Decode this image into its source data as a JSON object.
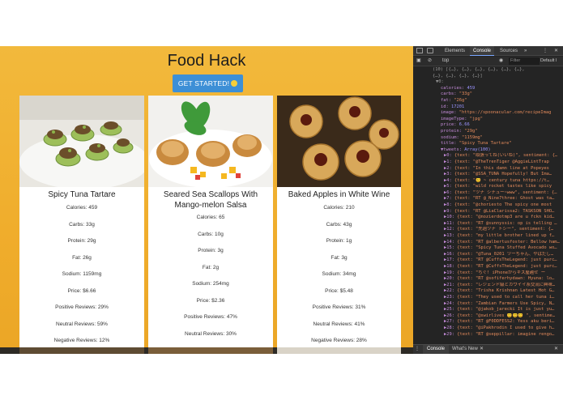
{
  "app": {
    "title": "Food Hack",
    "cta_label": "GET STARTED!",
    "recipes": [
      {
        "name": "Spicy Tuna Tartare",
        "stats": [
          "Calories: 459",
          "Carbs: 33g",
          "Protein: 29g",
          "Fat: 26g",
          "Sodium: 1159mg",
          "Price: $6.66",
          "Positive Reviews: 29%",
          "Neutral Reviews: 59%",
          "Negative Reviews: 12%"
        ]
      },
      {
        "name": "Seared Sea Scallops With Mango-melon Salsa",
        "stats": [
          "Calories: 65",
          "Carbs: 10g",
          "Protein: 3g",
          "Fat: 2g",
          "Sodium: 254mg",
          "Price: $2.36",
          "Positive Reviews: 47%",
          "Neutral Reviews: 30%",
          "Negative Reviews: 23%"
        ]
      },
      {
        "name": "Baked Apples in White Wine",
        "stats": [
          "Calories: 210",
          "Carbs: 43g",
          "Protein: 1g",
          "Fat: 3g",
          "Sodium: 34mg",
          "Price: $5.48",
          "Positive Reviews: 31%",
          "Neutral Reviews: 41%",
          "Negative Reviews: 28%"
        ]
      }
    ]
  },
  "devtools": {
    "tabs": [
      "Elements",
      "Console",
      "Sources",
      "»"
    ],
    "context": "top",
    "filter_placeholder": "Filter",
    "level": "Default l",
    "console_lines": [
      "(10) [{…}, {…}, {…}, {…}, {…}, {…},",
      "{…}, {…}, {…}, {…}] ",
      "▼0:",
      "calories: 459",
      "carbs: \"33g\"",
      "fat: \"26g\"",
      "id: 17201",
      "image: \"https://spoonacular.com/recipeImag",
      "imageType: \"jpg\"",
      "price: 6.66",
      "protein: \"29g\"",
      "sodium: \"1159mg\"",
      "title: \"Spicy Tuna Tartare\"",
      "▼tweets: Array(100)",
      "▶0: {text: \"頑張ってね(いいね)\", sentiment: {…",
      "▶1: {text: \"@TheTrenTiger @AggieLintTrap",
      "▶2: {text: \"In this damn line at Popeyes",
      "▶3: {text: \"@SSA_TUNA Hopefully! But Ima…",
      "▶4: {text: \"😊 ~ century tuna https://t…",
      "▶5: {text: \"wild rocket tastes like spicy",
      "▶6: {text: \"ツナ シチュー~www\", sentiment: {…",
      "▶7: {text: \"RT @_Nine7three: Ghost was ta…",
      "▶8: {text: \"@choriesto The spicy one most",
      "▶9: {text: \"RT @LiaClarissa2: TASKSON SHO…",
      "▶10: {text: \"@nozierdotmp3 are u fckn kid…",
      "▶11: {text: \"RT @sunnyssis: op is telling …",
      "▶12: {text: \"先週ツナ トシー\", sentiment: {…",
      "▶13: {text: \"my little brother lined up f…",
      "▶14: {text: \"RT @albertusfoster: Bellow ham…",
      "▶15: {text: \"Spicy Tuna Stuffed Avocado wo…",
      "▶16: {text: \"@Tuna_0201 ツーちゃん、やばだし…",
      "▶17: {text: \"RT @CuffsTheLegend: just purc…",
      "▶18: {text: \"RT @CuffsTheLegend: just purc…",
      "▶19: {text: \"ちぐ! iPhoneからキス屋越せ ー",
      "▶20: {text: \"RT @sofiferhydawn: Hyuna: lo…",
      "▶21: {text: \"レジェンド級とカワイイ系交流に興味…",
      "▶22: {text: \"Trisha Krishnan Latest Hot G…",
      "▶23: {text: \"They used to call her tuna i…",
      "▶24: {text: \"Zambian Farmers Use Spicy, N…",
      "▶25: {text: \"@jakob_jarecki It is just yu…",
      "▶26: {text: \"@swirlives 😊😊😊 \", sentime…",
      "▶27: {text: \"RT @F0DDFESS2: Yess aku beri…",
      "▶28: {text: \"@iPakhrodin I used to give h…",
      "▶29: {text: \"RT @seppillar: imagine rengo…"
    ],
    "drawer_tabs": [
      "Console",
      "What's New"
    ]
  }
}
